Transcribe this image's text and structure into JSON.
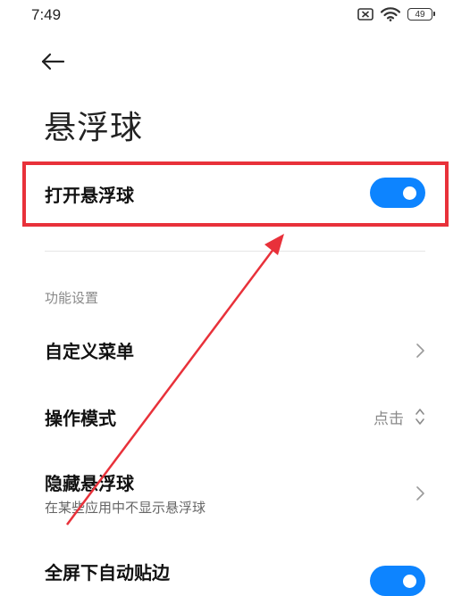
{
  "status_bar": {
    "time": "7:49",
    "battery_level": "49",
    "icons": [
      "sim-off-icon",
      "wifi-icon",
      "battery-icon"
    ]
  },
  "header": {
    "back_icon": "arrow-left-icon",
    "title": "悬浮球"
  },
  "main_toggle": {
    "label": "打开悬浮球",
    "on": true
  },
  "section": {
    "header": "功能设置"
  },
  "settings": [
    {
      "label": "自定义菜单",
      "control": "chevron"
    },
    {
      "label": "操作模式",
      "value": "点击",
      "control": "updown"
    },
    {
      "label": "隐藏悬浮球",
      "subtitle": "在某些应用中不显示悬浮球",
      "control": "chevron"
    },
    {
      "label": "全屏下自动贴边",
      "control": "toggle",
      "on": true
    }
  ],
  "colors": {
    "accent": "#0d84ff",
    "highlight": "#e8313a",
    "secondary_text": "#8a8a8a"
  }
}
